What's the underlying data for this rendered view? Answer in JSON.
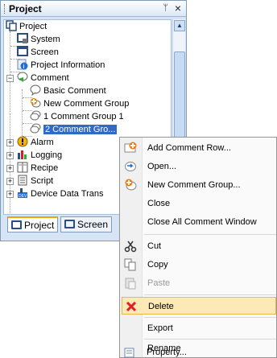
{
  "panel": {
    "title": "Project",
    "pin_glyph": "ᛘ",
    "close_glyph": "×"
  },
  "tree": {
    "items": [
      {
        "label": "Project",
        "icon": "project-icon"
      },
      {
        "label": "System",
        "icon": "system-icon"
      },
      {
        "label": "Screen",
        "icon": "screen-icon"
      },
      {
        "label": "Project Information",
        "icon": "info-icon"
      },
      {
        "label": "Comment",
        "icon": "comment-icon"
      },
      {
        "label": "Basic Comment",
        "icon": "comment-bubble-icon"
      },
      {
        "label": "New Comment Group",
        "icon": "new-comment-group-icon"
      },
      {
        "label": "1 Comment Group 1",
        "icon": "comment-group-icon"
      },
      {
        "label": "2 Comment Gro...",
        "icon": "comment-group-icon"
      },
      {
        "label": "Alarm",
        "icon": "alarm-icon"
      },
      {
        "label": "Logging",
        "icon": "logging-icon"
      },
      {
        "label": "Recipe",
        "icon": "recipe-icon"
      },
      {
        "label": "Script",
        "icon": "script-icon"
      },
      {
        "label": "Device Data Trans",
        "icon": "device-data-icon"
      }
    ]
  },
  "tabs": [
    {
      "label": "Project",
      "active": true
    },
    {
      "label": "Screen",
      "active": false
    }
  ],
  "context_menu": {
    "items": [
      {
        "label": "Add Comment Row...",
        "icon": "add-row-icon",
        "disabled": false
      },
      {
        "label": "Open...",
        "icon": "open-icon",
        "disabled": false
      },
      {
        "label": "New Comment Group...",
        "icon": "new-group-icon",
        "disabled": false
      },
      {
        "label": "Close",
        "icon": "",
        "disabled": false
      },
      {
        "label": "Close All Comment Window",
        "icon": "",
        "disabled": false
      },
      {
        "label": "Cut",
        "icon": "scissors-icon",
        "disabled": false
      },
      {
        "label": "Copy",
        "icon": "copy-icon",
        "disabled": false
      },
      {
        "label": "Paste",
        "icon": "paste-icon",
        "disabled": true
      },
      {
        "label": "Delete",
        "icon": "delete-icon",
        "disabled": false,
        "highlighted": true
      },
      {
        "label": "Export",
        "icon": "",
        "disabled": false
      },
      {
        "label": "Rename",
        "icon": "",
        "disabled": false
      },
      {
        "label": "Property...",
        "icon": "property-icon",
        "disabled": false
      }
    ]
  },
  "colors": {
    "selection": "#316ac5",
    "menu_highlight": "#fde9b6",
    "delete_red": "#e02020",
    "panel_bg": "#d6e4f5"
  }
}
